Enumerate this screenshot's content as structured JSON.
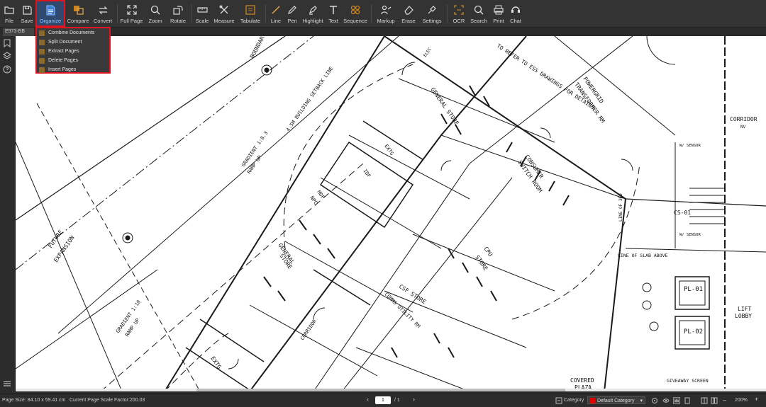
{
  "toolbar": {
    "items": [
      {
        "id": "file",
        "label": "File",
        "icon": "folder-icon"
      },
      {
        "id": "save",
        "label": "Save",
        "icon": "save-icon"
      },
      {
        "id": "organize",
        "label": "Organize",
        "icon": "document-icon"
      },
      {
        "id": "compare",
        "label": "Compare",
        "icon": "compare-icon"
      },
      {
        "id": "convert",
        "label": "Convert",
        "icon": "convert-icon"
      },
      {
        "id": "fullpage",
        "label": "Full Page",
        "icon": "expand-icon"
      },
      {
        "id": "zoom",
        "label": "Zoom",
        "icon": "zoom-icon"
      },
      {
        "id": "rotate",
        "label": "Rotate",
        "icon": "rotate-icon"
      },
      {
        "id": "scale",
        "label": "Scale",
        "icon": "ruler-icon"
      },
      {
        "id": "measure",
        "label": "Measure",
        "icon": "measure-icon"
      },
      {
        "id": "tabulate",
        "label": "Tabulate",
        "icon": "tabulate-icon"
      },
      {
        "id": "line",
        "label": "Line",
        "icon": "line-icon"
      },
      {
        "id": "pen",
        "label": "Pen",
        "icon": "pen-icon"
      },
      {
        "id": "highlight",
        "label": "Highlight",
        "icon": "highlight-icon"
      },
      {
        "id": "text",
        "label": "Text",
        "icon": "text-icon"
      },
      {
        "id": "sequence",
        "label": "Sequence",
        "icon": "sequence-icon"
      },
      {
        "id": "markup",
        "label": "Markup",
        "icon": "markup-icon"
      },
      {
        "id": "erase",
        "label": "Erase",
        "icon": "eraser-icon"
      },
      {
        "id": "settings",
        "label": "Settings",
        "icon": "settings-icon"
      },
      {
        "id": "ocr",
        "label": "OCR",
        "icon": "ocr-icon"
      },
      {
        "id": "search",
        "label": "Search",
        "icon": "search-icon"
      },
      {
        "id": "print",
        "label": "Print",
        "icon": "print-icon"
      },
      {
        "id": "chat",
        "label": "Chat",
        "icon": "chat-icon"
      }
    ],
    "active": "organize",
    "active_color": "#e0141e"
  },
  "tab": {
    "label": "E973-BB"
  },
  "organize_menu": {
    "items": [
      {
        "label": "Combine Documents"
      },
      {
        "label": "Split Document"
      },
      {
        "label": "Extract Pages"
      },
      {
        "label": "Delete Pages"
      },
      {
        "label": "Insert Pages"
      }
    ]
  },
  "drawing": {
    "labels": {
      "boundary": "BOUNDARY",
      "setback": "4.5M BUILDING SETBACK LINE",
      "gradient1": "GRADIENT 1:8.3",
      "ramp1": "RAMP UP",
      "gradient2": "GRADIENT 1:10",
      "ramp2": "RAMP UP",
      "future": "FUTURE",
      "expansion": "EXPANSION",
      "ess_note": "TO REFER TO ESS DRAWINGS FOR DETAILS",
      "powergrid": "POWERGRID",
      "transformer": "TRANSFORMER RM",
      "general_store_top": "GENERAL STORE",
      "consumer": "CONSUMER",
      "switch_room": "SWITCH ROOM",
      "extg": "EXTG",
      "idf": "IDF",
      "mdf": "MDF",
      "npc": "NPC",
      "general_store_mid": "GENERAL",
      "store": "STORE",
      "cpu": "CPU",
      "cpu_store": "STORE",
      "csf_store": "CSF STORE",
      "comms": "COMMS UTILITY RM",
      "corridor_mid": "CORRIDOR",
      "extg_bottom": "EXTG",
      "corridor_right": "CORRIDOR",
      "cs": "CS-01",
      "line_of_slab": "LINE OF SLAB ABOVE",
      "line_of_3rd": "LINE OF 3RD",
      "pl01": "PL-01",
      "pl02": "PL-02",
      "lift": "LIFT",
      "lobby": "LOBBY",
      "covered": "COVERED",
      "plaza": "PLAZA",
      "giveaway": "GIVEAWAY SCREEN",
      "sensor1": "W/ SENSOR",
      "sensor2": "W/ SENSOR",
      "elec": "ELEC",
      "nv": "NV"
    }
  },
  "statusbar": {
    "page_size": "Page Size: 84.10 x 59.41 cm",
    "scale_factor": "Current Page Scale Factor:200.03",
    "page_current": "1",
    "page_total": "/ 1",
    "category_label": "Category",
    "category_value": "Default Category",
    "category_color": "#e00000",
    "zoom_level": "200%"
  }
}
